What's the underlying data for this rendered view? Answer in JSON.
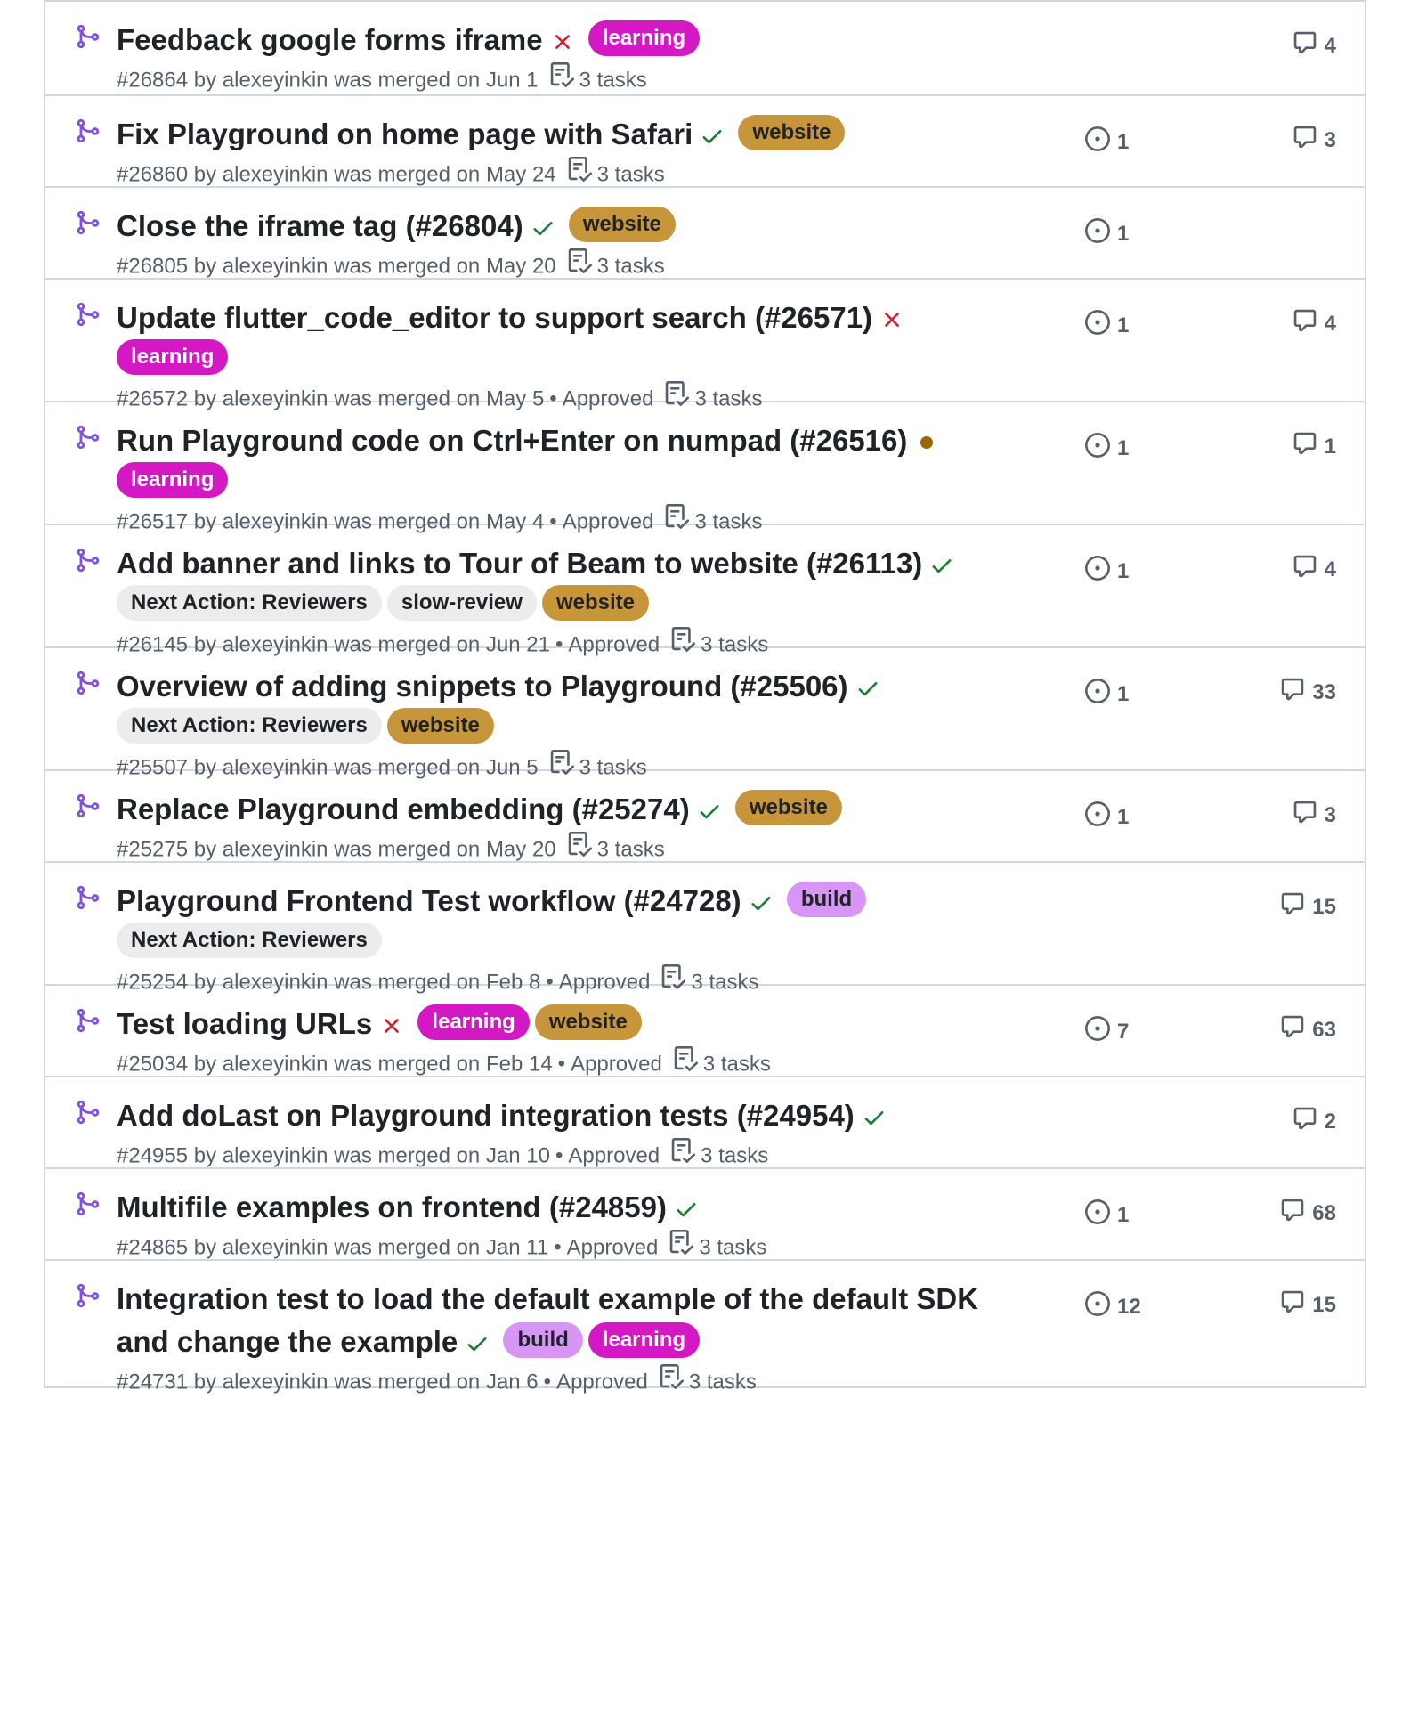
{
  "colors": {
    "merged_purple": "#8250df",
    "check_green": "#1a7f37",
    "x_red": "#cf222e",
    "pending_dot": "#9a6700"
  },
  "label_styles": {
    "learning": {
      "bg": "#d418c4",
      "fg": "#ffffff"
    },
    "website": {
      "bg": "#c8963a",
      "fg": "#1f2328"
    },
    "build": {
      "bg": "#d796f5",
      "fg": "#1f2328"
    },
    "Next Action: Reviewers": {
      "bg": "#ececec",
      "fg": "#1f2328"
    },
    "slow-review": {
      "bg": "#ececec",
      "fg": "#1f2328"
    }
  },
  "pull_requests": [
    {
      "title": "Feedback google forms iframe",
      "status": "failure",
      "labels": [
        "learning"
      ],
      "labels_inline": true,
      "number": "#26864",
      "author": "alexeyinkin",
      "merged": "was merged on Jun 1",
      "approved": "",
      "tasks": "3 tasks",
      "issues": "",
      "comments": "4",
      "height": 106
    },
    {
      "title": "Fix Playground on home page with Safari",
      "status": "success",
      "labels": [
        "website"
      ],
      "labels_inline": true,
      "number": "#26860",
      "author": "alexeyinkin",
      "merged": "was merged on May 24",
      "approved": "",
      "tasks": "3 tasks",
      "issues": "1",
      "comments": "3",
      "height": 103
    },
    {
      "title": "Close the iframe tag (#26804)",
      "status": "success",
      "labels": [
        "website"
      ],
      "labels_inline": true,
      "number": "#26805",
      "author": "alexeyinkin",
      "merged": "was merged on May 20",
      "approved": "",
      "tasks": "3 tasks",
      "issues": "1",
      "comments": "",
      "height": 103
    },
    {
      "title": "Update flutter_code_editor to support search (#26571)",
      "status": "failure",
      "labels": [
        "learning"
      ],
      "labels_inline": false,
      "number": "#26572",
      "author": "alexeyinkin",
      "merged": "was merged on May 5",
      "approved": "Approved",
      "tasks": "3 tasks",
      "issues": "1",
      "comments": "4",
      "height": 138
    },
    {
      "title": "Run Playground code on Ctrl+Enter on numpad (#26516)",
      "status": "pending",
      "labels": [
        "learning"
      ],
      "labels_inline": false,
      "number": "#26517",
      "author": "alexeyinkin",
      "merged": "was merged on May 4",
      "approved": "Approved",
      "tasks": "3 tasks",
      "issues": "1",
      "comments": "1",
      "height": 138
    },
    {
      "title": "Add banner and links to Tour of Beam to website (#26113)",
      "status": "success",
      "labels": [
        "Next Action: Reviewers",
        "slow-review",
        "website"
      ],
      "labels_inline": false,
      "number": "#26145",
      "author": "alexeyinkin",
      "merged": "was merged on Jun 21",
      "approved": "Approved",
      "tasks": "3 tasks",
      "issues": "1",
      "comments": "4",
      "height": 138
    },
    {
      "title": "Overview of adding snippets to Playground (#25506)",
      "status": "success",
      "labels": [
        "Next Action: Reviewers",
        "website"
      ],
      "labels_inline": false,
      "number": "#25507",
      "author": "alexeyinkin",
      "merged": "was merged on Jun 5",
      "approved": "",
      "tasks": "3 tasks",
      "issues": "1",
      "comments": "33",
      "height": 138
    },
    {
      "title": "Replace Playground embedding (#25274)",
      "status": "success",
      "labels": [
        "website"
      ],
      "labels_inline": true,
      "number": "#25275",
      "author": "alexeyinkin",
      "merged": "was merged on May 20",
      "approved": "",
      "tasks": "3 tasks",
      "issues": "1",
      "comments": "3",
      "height": 103
    },
    {
      "title": "Playground Frontend Test workflow (#24728)",
      "status": "success",
      "labels": [
        "build"
      ],
      "labels_inline": true,
      "labels_second": [
        "Next Action: Reviewers"
      ],
      "number": "#25254",
      "author": "alexeyinkin",
      "merged": "was merged on Feb 8",
      "approved": "Approved",
      "tasks": "3 tasks",
      "issues": "",
      "comments": "15",
      "height": 138
    },
    {
      "title": "Test loading URLs",
      "status": "failure",
      "labels": [
        "learning",
        "website"
      ],
      "labels_inline": true,
      "number": "#25034",
      "author": "alexeyinkin",
      "merged": "was merged on Feb 14",
      "approved": "Approved",
      "tasks": "3 tasks",
      "issues": "7",
      "comments": "63",
      "height": 103
    },
    {
      "title": "Add doLast on Playground integration tests (#24954)",
      "status": "success",
      "labels": [],
      "labels_inline": true,
      "number": "#24955",
      "author": "alexeyinkin",
      "merged": "was merged on Jan 10",
      "approved": "Approved",
      "tasks": "3 tasks",
      "issues": "",
      "comments": "2",
      "height": 103
    },
    {
      "title": "Multifile examples on frontend (#24859)",
      "status": "success",
      "labels": [],
      "labels_inline": true,
      "number": "#24865",
      "author": "alexeyinkin",
      "merged": "was merged on Jan 11",
      "approved": "Approved",
      "tasks": "3 tasks",
      "issues": "1",
      "comments": "68",
      "height": 103
    },
    {
      "title": "Integration test to load the default example of the default SDK and change the example",
      "status": "success",
      "labels": [
        "build",
        "learning"
      ],
      "labels_inline": true,
      "number": "#24731",
      "author": "alexeyinkin",
      "merged": "was merged on Jan 6",
      "approved": "Approved",
      "tasks": "3 tasks",
      "issues": "12",
      "comments": "15",
      "height": 143
    }
  ]
}
